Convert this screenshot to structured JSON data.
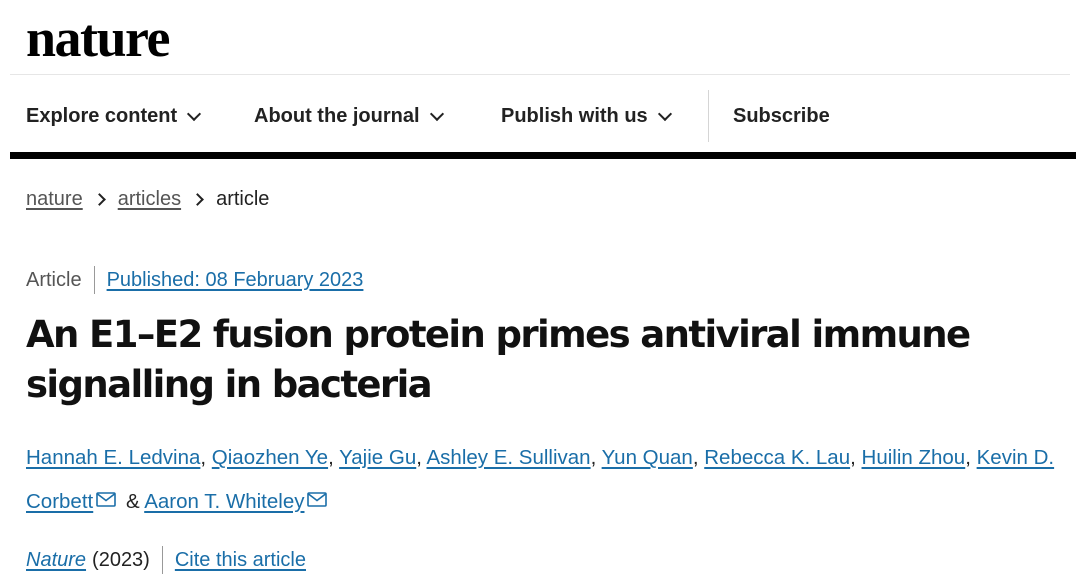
{
  "logo": "nature",
  "nav": {
    "items": [
      {
        "label": "Explore content"
      },
      {
        "label": "About the journal"
      },
      {
        "label": "Publish with us"
      },
      {
        "label": "Subscribe"
      }
    ]
  },
  "breadcrumbs": [
    "nature",
    "articles",
    "article"
  ],
  "article": {
    "type": "Article",
    "published": "Published: 08 February 2023",
    "title": "An E1–E2 fusion protein primes antiviral immune signalling in bacteria",
    "authors": [
      "Hannah E. Ledvina",
      "Qiaozhen Ye",
      "Yajie Gu",
      "Ashley E. Sullivan",
      "Yun Quan",
      "Rebecca K. Lau",
      "Huilin Zhou",
      "Kevin D. Corbett",
      "Aaron T. Whiteley"
    ],
    "author_separator": ",",
    "author_conjunction": "&",
    "journal": "Nature",
    "year": "(2023)",
    "cite_label": "Cite this article"
  },
  "icons": {
    "dropdown": "chevron-down-icon",
    "breadcrumb_sep": "chevron-right-icon",
    "contact": "envelope-icon"
  },
  "colors": {
    "link": "#1a6ea8",
    "text": "#222222",
    "rule": "#000000"
  }
}
